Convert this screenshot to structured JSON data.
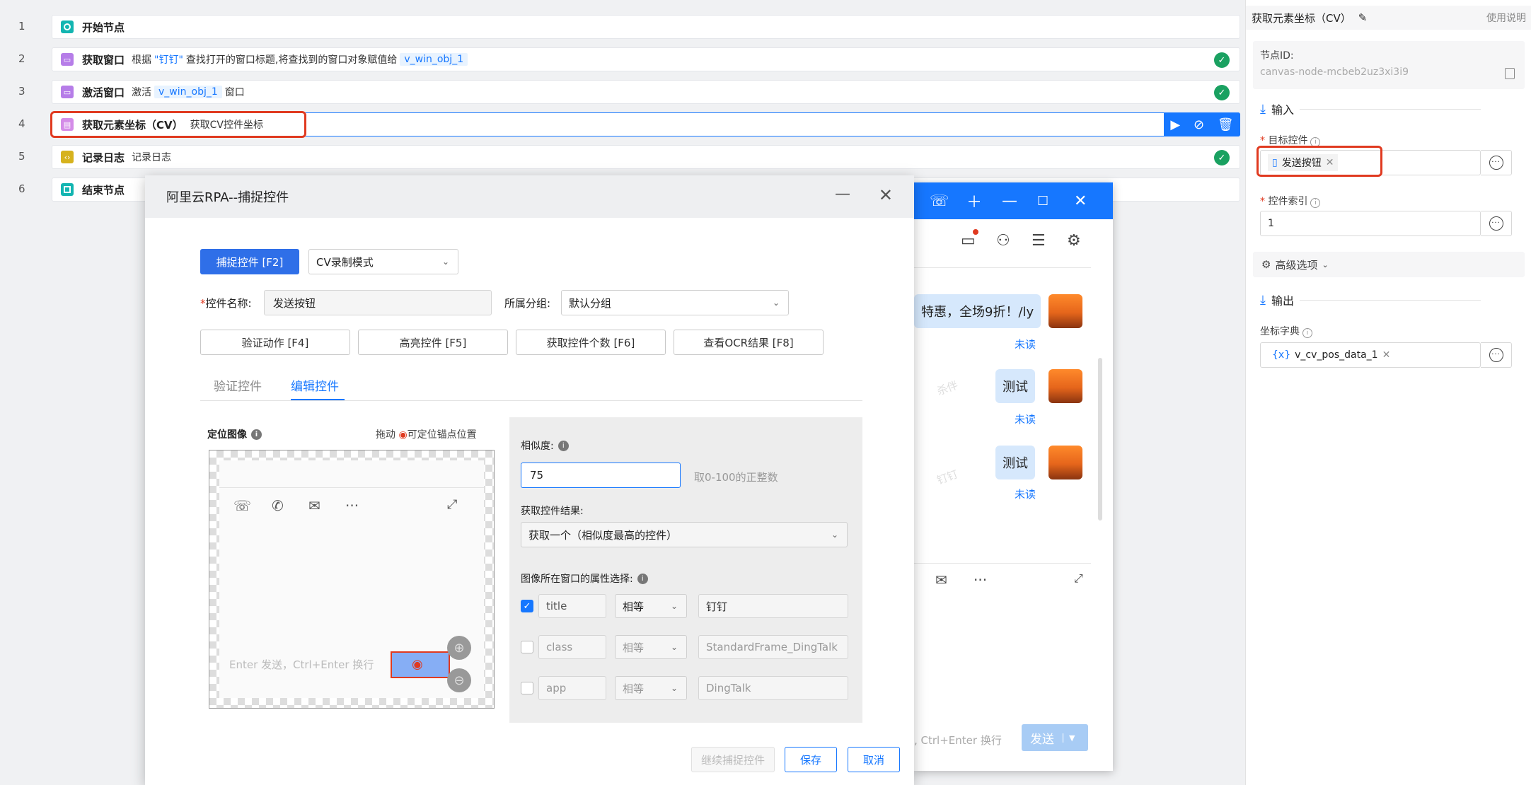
{
  "flow": {
    "rows": [
      {
        "num": "1",
        "title": "开始节点",
        "icon_color": "#13b5b1",
        "icon": "circle-icon"
      },
      {
        "num": "2",
        "title": "获取窗口",
        "desc_pre": "根据",
        "quote": "\"钉钉\"",
        "desc_mid": "查找打开的窗口标题,将查找到的窗口对象赋值给",
        "var": "v_win_obj_1",
        "icon_color": "#b67de8",
        "icon": "window-icon"
      },
      {
        "num": "3",
        "title": "激活窗口",
        "desc_pre": "激活",
        "var": "v_win_obj_1",
        "desc_post": "窗口",
        "icon_color": "#b67de8",
        "icon": "window-icon"
      },
      {
        "num": "4",
        "title": "获取元素坐标（CV）",
        "desc": "获取CV控件坐标",
        "icon_color": "#d48ce8",
        "icon": "element-icon"
      },
      {
        "num": "5",
        "title": "记录日志",
        "desc": "记录日志",
        "icon_color": "#d6b21d",
        "icon": "code-icon"
      },
      {
        "num": "6",
        "title": "结束节点",
        "icon_color": "#13b5b1",
        "icon": "square-icon"
      }
    ]
  },
  "panel": {
    "title": "获取元素坐标（CV）",
    "help": "使用说明",
    "node_id_label": "节点ID:",
    "node_id": "canvas-node-mcbeb2uz3xi3i9",
    "input_section": "输入",
    "target_label": "目标控件",
    "target_value": "发送按钮",
    "index_label": "控件索引",
    "index_value": "1",
    "advanced": "高级选项",
    "output_section": "输出",
    "coord_label": "坐标字典",
    "coord_value": "v_cv_pos_data_1",
    "coord_tag": "{x}"
  },
  "chat": {
    "bubble1": "特惠，全场9折！/ly",
    "bubble2": "测试",
    "bubble3": "测试",
    "unread": "未读",
    "watermark1": "杀伴",
    "watermark2": "钉钉",
    "input_hint": ", Ctrl+Enter 换行",
    "send": "发送"
  },
  "dialog": {
    "title": "阿里云RPA--捕捉控件",
    "capture_btn": "捕捉控件 [F2]",
    "mode": "CV录制模式",
    "name_label": "控件名称:",
    "name_value": "发送按钮",
    "group_label": "所属分组:",
    "group_value": "默认分组",
    "verify_btn": "验证动作 [F4]",
    "highlight_btn": "高亮控件 [F5]",
    "count_btn": "获取控件个数 [F6]",
    "ocr_btn": "查看OCR结果 [F8]",
    "tab_verify": "验证控件",
    "tab_edit": "编辑控件",
    "locate_label": "定位图像",
    "drag_hint_pre": "拖动",
    "drag_hint_post": "可定位锚点位置",
    "preview_hint": "Enter 发送，Ctrl+Enter 换行",
    "similarity_label": "相似度:",
    "similarity_value": "75",
    "similarity_hint": "取0-100的正整数",
    "result_label": "获取控件结果:",
    "result_value": "获取一个（相似度最高的控件）",
    "attr_label": "图像所在窗口的属性选择:",
    "attrs": [
      {
        "name": "title",
        "op": "相等",
        "value": "钉钉",
        "checked": true
      },
      {
        "name": "class",
        "op": "相等",
        "value": "StandardFrame_DingTalk",
        "checked": false
      },
      {
        "name": "app",
        "op": "相等",
        "value": "DingTalk",
        "checked": false
      }
    ],
    "continue_btn": "继续捕捉控件",
    "save_btn": "保存",
    "cancel_btn": "取消"
  },
  "colors": {
    "accent": "#1677ff",
    "success": "#1aa161",
    "highlight": "#e03a20"
  }
}
